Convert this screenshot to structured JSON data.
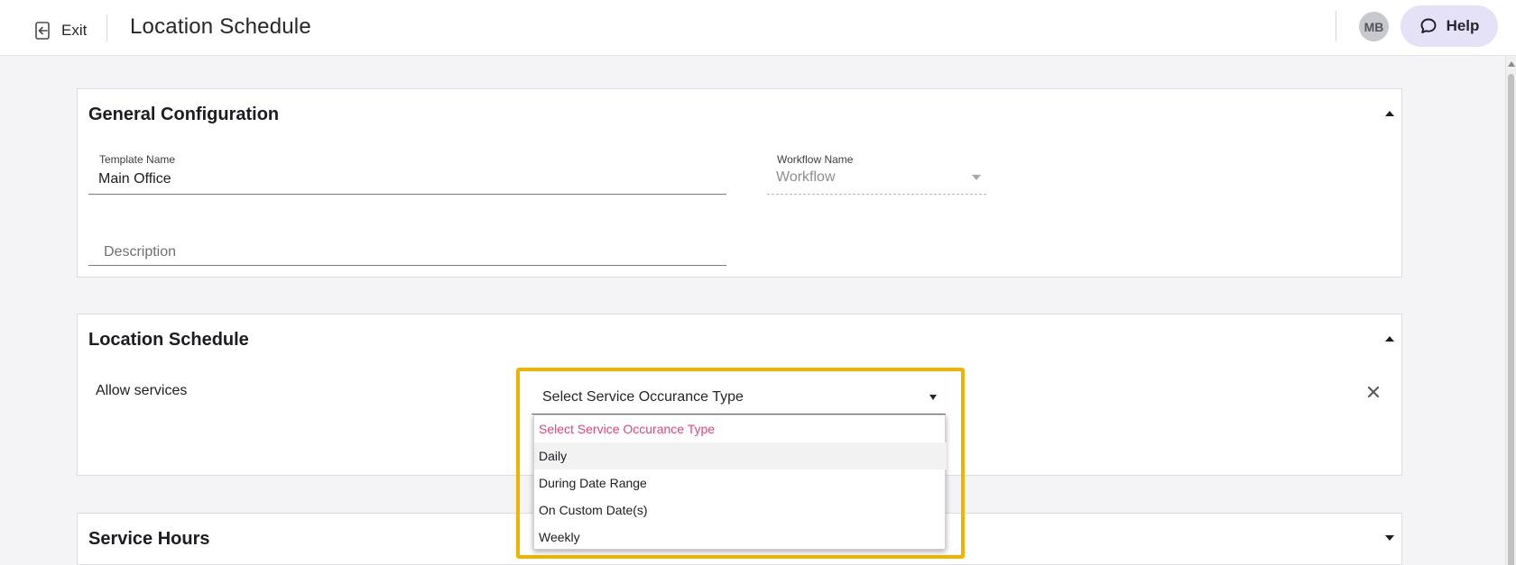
{
  "header": {
    "exit_label": "Exit",
    "title": "Location Schedule",
    "avatar_initials": "MB",
    "help_label": "Help"
  },
  "general": {
    "title": "General Configuration",
    "template_name_label": "Template Name",
    "template_name_value": "Main Office",
    "workflow_label": "Workflow Name",
    "workflow_placeholder": "Workflow",
    "description_placeholder": "Description"
  },
  "schedule": {
    "title": "Location Schedule",
    "allow_label": "Allow services",
    "select_value": "Select Service Occurance Type",
    "options": [
      "Select Service Occurance Type",
      "Daily",
      "During Date Range",
      "On Custom Date(s)",
      "Weekly"
    ]
  },
  "hours": {
    "title": "Service Hours"
  },
  "colors": {
    "accent": "#e5e1f7",
    "highlight": "#f0b400",
    "placeholder_option": "#e2457a",
    "select_underline": "#3a7bd5"
  }
}
